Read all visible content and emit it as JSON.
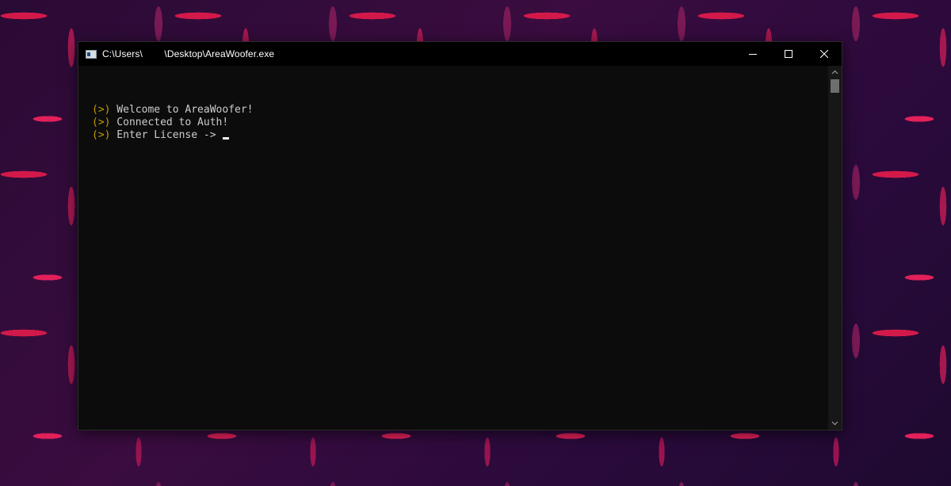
{
  "window": {
    "title_part1": "C:\\Users\\",
    "title_gap": "        ",
    "title_part2": "\\Desktop\\AreaWoofer.exe",
    "icon": "console-app-icon"
  },
  "controls": {
    "minimize_icon": "minimize-icon",
    "maximize_icon": "maximize-icon",
    "close_icon": "close-icon"
  },
  "console": {
    "lines": [
      {
        "prompt": "(>)",
        "text": " Welcome to AreaWoofer!"
      },
      {
        "prompt": "(>)",
        "text": " Connected to Auth!"
      },
      {
        "prompt": "(>)",
        "text": " Enter License -> "
      }
    ],
    "prompt_color": "#c19c00",
    "text_color": "#cccccc",
    "background_color": "#0c0c0c"
  },
  "scrollbar": {
    "up_icon": "scroll-up-arrow-icon",
    "down_icon": "scroll-down-arrow-icon"
  }
}
